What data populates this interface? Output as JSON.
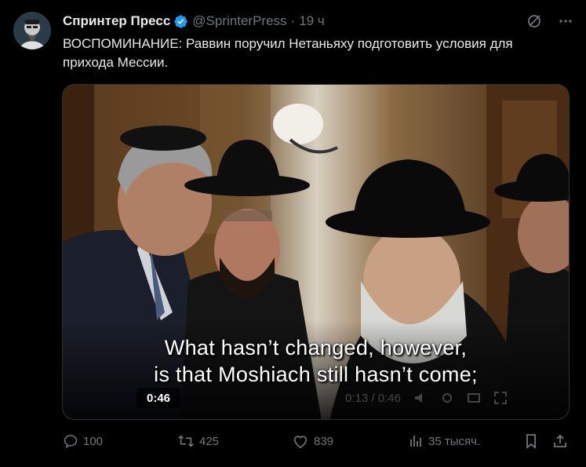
{
  "author": {
    "display_name": "Спринтер Пресс",
    "handle": "@SprinterPress",
    "separator": "·",
    "time": "19 ч",
    "verified": true
  },
  "header_icons": [
    "grok-icon",
    "more-icon"
  ],
  "tweet": {
    "text": "ВОСПОМИНАНИЕ: Раввин поручил Нетаньяху подготовить условия для прихода Мессии."
  },
  "video": {
    "subtitle_line1": "What hasn’t changed, however,",
    "subtitle_line2": "is that Moshiach still hasn’t come;",
    "duration": "0:46",
    "player_time": "0:13 / 0:46"
  },
  "actions": {
    "reply_count": "100",
    "retweet_count": "425",
    "like_count": "839",
    "views_count": "35 тысяч."
  },
  "colors": {
    "background": "#000000",
    "text": "#e7e9ea",
    "muted": "#71767b",
    "verified": "#1d9bf0"
  }
}
